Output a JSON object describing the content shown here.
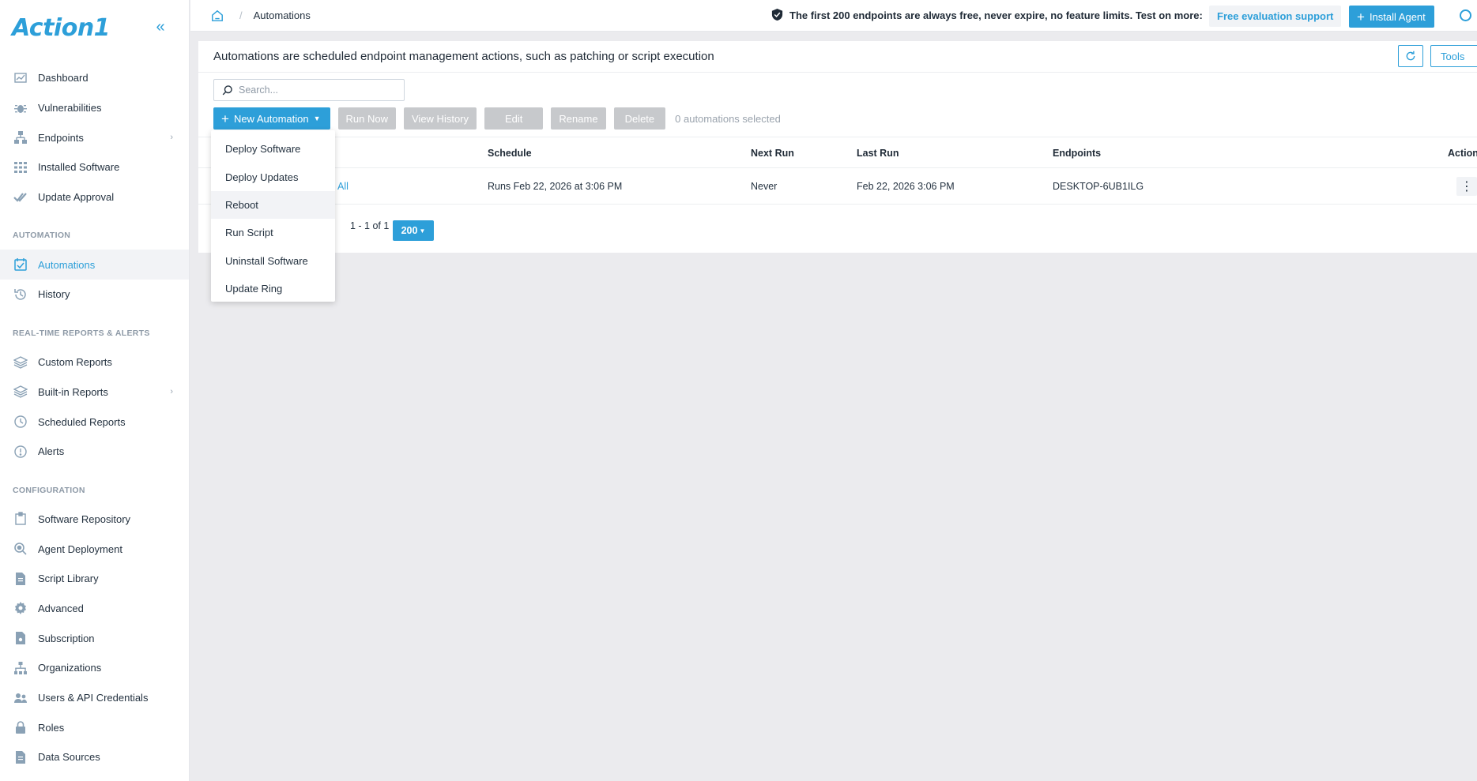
{
  "app": {
    "logo": "Action1"
  },
  "sidebar": {
    "items_main": [
      {
        "label": "Dashboard",
        "icon": "chart-icon"
      },
      {
        "label": "Vulnerabilities",
        "icon": "bug-icon"
      },
      {
        "label": "Endpoints",
        "icon": "network-icon",
        "has_children": true
      },
      {
        "label": "Installed Software",
        "icon": "grid-icon"
      },
      {
        "label": "Update Approval",
        "icon": "double-check-icon"
      }
    ],
    "section_automation": "AUTOMATION",
    "items_automation": [
      {
        "label": "Automations",
        "icon": "calendar-check-icon",
        "active": true
      },
      {
        "label": "History",
        "icon": "history-icon"
      }
    ],
    "section_reports": "REAL-TIME REPORTS & ALERTS",
    "items_reports": [
      {
        "label": "Custom Reports",
        "icon": "layers-icon"
      },
      {
        "label": "Built-in Reports",
        "icon": "layers-icon",
        "has_children": true
      },
      {
        "label": "Scheduled Reports",
        "icon": "clock-icon"
      },
      {
        "label": "Alerts",
        "icon": "alert-icon"
      }
    ],
    "section_config": "CONFIGURATION",
    "items_config": [
      {
        "label": "Software Repository",
        "icon": "package-icon"
      },
      {
        "label": "Agent Deployment",
        "icon": "magnify-icon"
      },
      {
        "label": "Script Library",
        "icon": "file-icon"
      },
      {
        "label": "Advanced",
        "icon": "gear-icon"
      },
      {
        "label": "Subscription",
        "icon": "document-icon"
      },
      {
        "label": "Organizations",
        "icon": "org-icon"
      },
      {
        "label": "Users & API Credentials",
        "icon": "users-icon"
      },
      {
        "label": "Roles",
        "icon": "lock-icon"
      },
      {
        "label": "Data Sources",
        "icon": "file-icon"
      }
    ]
  },
  "topbar": {
    "breadcrumb": "Automations",
    "promo": "The first 200 endpoints are always free, never expire, no feature limits. Test on more:",
    "free_eval": "Free evaluation support",
    "install_agent": "Install Agent"
  },
  "main": {
    "description": "Automations are scheduled endpoint management actions, such as patching or script execution",
    "tools_label": "Tools",
    "search_placeholder": "Search...",
    "toolbar": {
      "new_automation": "New Automation",
      "run_now": "Run Now",
      "view_history": "View History",
      "edit": "Edit",
      "rename": "Rename",
      "delete": "Delete",
      "selected": "0 automations selected"
    },
    "columns": {
      "schedule": "Schedule",
      "next_run": "Next Run",
      "last_run": "Last Run",
      "endpoints": "Endpoints",
      "actions": "Actions"
    },
    "rows": [
      {
        "name_fragment": "All",
        "schedule": "Runs Feb 22, 2026 at 3:06 PM",
        "next_run": "Never",
        "last_run": "Feb 22, 2026 3:06 PM",
        "endpoints": "DESKTOP-6UB1ILG"
      }
    ],
    "pager": {
      "range": "1 - 1 of 1",
      "page_size": "200"
    },
    "dropdown": [
      "Deploy Software",
      "Deploy Updates",
      "Reboot",
      "Run Script",
      "Uninstall Software",
      "Update Ring"
    ]
  },
  "colors": {
    "accent": "#2d9fd9",
    "disabled": "#c7c9cc",
    "page_bg": "#ebebee"
  }
}
